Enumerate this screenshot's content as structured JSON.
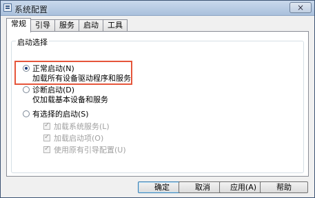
{
  "window": {
    "title": "系统配置",
    "close_label": "×"
  },
  "tabs": [
    {
      "label": "常规",
      "active": true
    },
    {
      "label": "引导",
      "active": false
    },
    {
      "label": "服务",
      "active": false
    },
    {
      "label": "启动",
      "active": false
    },
    {
      "label": "工具",
      "active": false
    }
  ],
  "startup": {
    "group_title": "启动选择",
    "normal": {
      "label": "正常启动(N)",
      "desc": "加载所有设备驱动程序和服务",
      "selected": true
    },
    "diagnostic": {
      "label": "诊断启动(D)",
      "desc": "仅加载基本设备和服务",
      "selected": false
    },
    "selective": {
      "label": "有选择的启动(S)",
      "selected": false
    },
    "options": [
      {
        "label": "加载系统服务(L)",
        "checked": true,
        "enabled": false
      },
      {
        "label": "加载启动项(O)",
        "checked": true,
        "enabled": false
      },
      {
        "label": "使用原有引导配置(U)",
        "checked": true,
        "enabled": false
      }
    ]
  },
  "buttons": {
    "ok": "确定",
    "cancel": "取消",
    "apply": "应用(A)",
    "help": "帮助"
  },
  "colors": {
    "highlight": "#e5553a",
    "titlebar": "#b7cbe4"
  }
}
